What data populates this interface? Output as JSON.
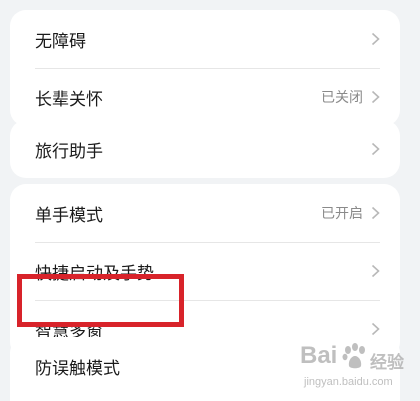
{
  "settings": {
    "group1": [
      {
        "label": "无障碍",
        "value": ""
      },
      {
        "label": "长辈关怀",
        "value": "已关闭"
      }
    ],
    "group2": [
      {
        "label": "旅行助手",
        "value": ""
      }
    ],
    "group3": [
      {
        "label": "单手模式",
        "value": "已开启"
      },
      {
        "label": "快捷启动及手势",
        "value": ""
      },
      {
        "label": "智慧多窗",
        "value": ""
      }
    ],
    "group4": [
      {
        "label": "防误触模式",
        "value": ""
      }
    ]
  },
  "watermark": {
    "brand_left": "Bai",
    "brand_right": "经验",
    "url": "jingyan.baidu.com"
  },
  "colors": {
    "background": "#f1f3f5",
    "card": "#ffffff",
    "highlight_border": "#d8232a",
    "secondary_text": "#8a8a8a"
  }
}
